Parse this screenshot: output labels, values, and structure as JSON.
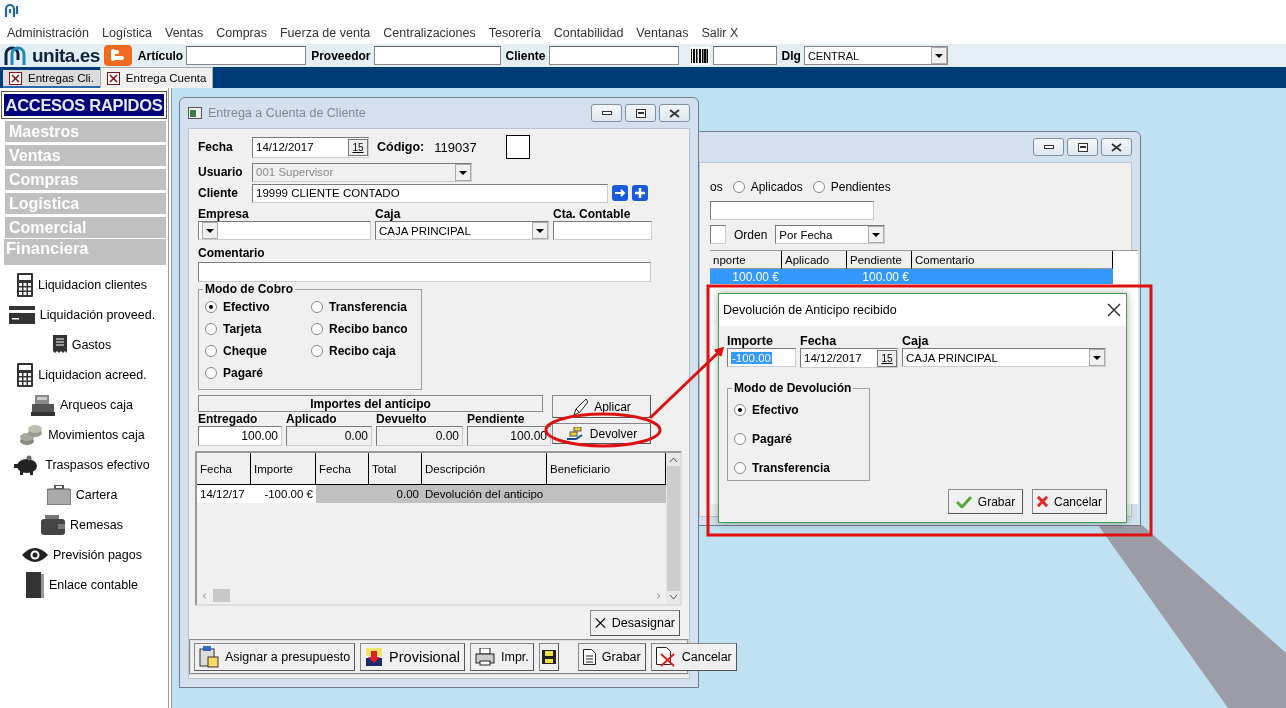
{
  "menu": [
    "Administración",
    "Logística",
    "Ventas",
    "Compras",
    "Fuerza de venta",
    "Centralizaciones",
    "Tesorería",
    "Contabilidad",
    "Ventanas",
    "Salir X"
  ],
  "toolbar": {
    "brand": "unita.es",
    "fields": [
      {
        "label": "Artículo"
      },
      {
        "label": "Proveedor"
      },
      {
        "label": "Cliente"
      }
    ],
    "dlg_label": "Dlg",
    "dlg_value": "CENTRAL"
  },
  "tabs": [
    {
      "label": "Entregas Cli.",
      "selected": false
    },
    {
      "label": "Entrega Cuenta",
      "selected": true
    }
  ],
  "sidebar": {
    "title": "ACCESOS RAPIDOS",
    "sections": [
      {
        "label": "Maestros",
        "expanded": false
      },
      {
        "label": "Ventas",
        "expanded": false
      },
      {
        "label": "Compras",
        "expanded": false
      },
      {
        "label": "Logística",
        "expanded": false
      },
      {
        "label": "Comercial",
        "expanded": false
      },
      {
        "label": "Financiera",
        "expanded": true,
        "items": [
          "Liquidacion clientes",
          "Liquidación proveed.",
          "Gastos",
          "Liquidacion acreed.",
          "Arqueos caja",
          "Movimientos caja",
          "Traspasos efectivo",
          "Cartera",
          "Remesas",
          "Previsión pagos",
          "Enlace contable"
        ]
      }
    ]
  },
  "entrega": {
    "title": "Entrega a Cuenta de Cliente",
    "fecha_label": "Fecha",
    "fecha": "14/12/2017",
    "calendar_day": "15",
    "codigo_label": "Código:",
    "codigo": "119037",
    "usuario_label": "Usuario",
    "usuario": "001 Supervisor",
    "usuario_disabled": true,
    "cliente_label": "Cliente",
    "cliente": "19999 CLIENTE CONTADO",
    "empresa_label": "Empresa",
    "caja_label": "Caja",
    "caja": "CAJA PRINCIPAL",
    "cta_label": "Cta. Contable",
    "comentario_label": "Comentario",
    "modo": {
      "title": "Modo de Cobro",
      "options": [
        {
          "label": "Efectivo",
          "selected": true
        },
        {
          "label": "Transferencia",
          "selected": false
        },
        {
          "label": "Tarjeta",
          "selected": false
        },
        {
          "label": "Recibo banco",
          "selected": false
        },
        {
          "label": "Cheque",
          "selected": false
        },
        {
          "label": "Recibo caja",
          "selected": false
        },
        {
          "label": "Pagaré",
          "selected": false
        }
      ]
    },
    "importes": {
      "title": "Importes del anticipo",
      "items": [
        {
          "label": "Entregado",
          "value": "100.00",
          "disabled": false
        },
        {
          "label": "Aplicado",
          "value": "0.00",
          "disabled": true
        },
        {
          "label": "Devuelto",
          "value": "0.00",
          "disabled": true
        },
        {
          "label": "Pendiente",
          "value": "100.00",
          "disabled": true
        }
      ]
    },
    "aplicar": "Aplicar",
    "devolver": "Devolver",
    "table": {
      "columns": [
        "Fecha",
        "Importe",
        "Fecha",
        "Total",
        "Descripción",
        "Beneficiario"
      ],
      "rows": [
        {
          "fecha": "14/12/17",
          "importe": "-100.00 €",
          "total": "0.00",
          "descripcion": "Devolución del anticipo"
        }
      ]
    },
    "desasignar": "Desasignar",
    "buttons": [
      "Asignar a presupuesto",
      "Provisional",
      "Impr.",
      "Grabar",
      "Cancelar"
    ]
  },
  "listado": {
    "partial_label": "os",
    "filters": [
      {
        "label": "Aplicados",
        "selected": false
      },
      {
        "label": "Pendientes",
        "selected": false
      }
    ],
    "orden_label": "Orden",
    "orden": "Por Fecha",
    "columns": [
      "nporte",
      "Aplicado",
      "Pendiente",
      "Comentario"
    ],
    "rows": [
      {
        "importe": "100.00 €",
        "pendiente": "100.00 €",
        "selected": true
      }
    ]
  },
  "devolucion": {
    "title": "Devolución de Anticipo recibido",
    "importe_label": "Importe",
    "importe": "-100.00",
    "importe_highlighted": true,
    "fecha_label": "Fecha",
    "fecha": "14/12/2017",
    "calendar_day": "15",
    "caja_label": "Caja",
    "caja": "CAJA PRINCIPAL",
    "modo": {
      "title": "Modo de Devolución",
      "options": [
        {
          "label": "Efectivo",
          "selected": true
        },
        {
          "label": "Pagaré",
          "selected": false
        },
        {
          "label": "Transferencia",
          "selected": false
        }
      ]
    },
    "buttons": [
      "Grabar",
      "Cancelar"
    ]
  }
}
